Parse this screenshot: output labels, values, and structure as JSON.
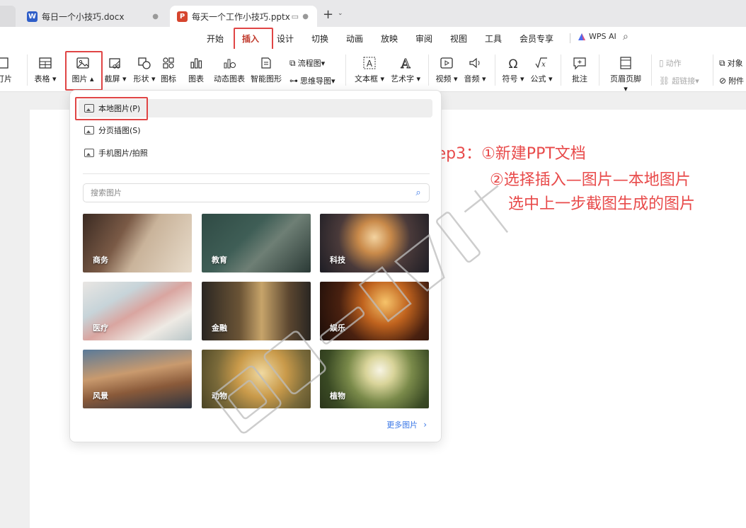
{
  "tabs": {
    "doc1": "每日一个小技巧.docx",
    "doc2": "每天一个工作小技巧.pptx",
    "new_tab": "+"
  },
  "ribbon_tabs": [
    "开始",
    "插入",
    "设计",
    "切换",
    "动画",
    "放映",
    "审阅",
    "视图",
    "工具",
    "会员专享"
  ],
  "active_tab": "插入",
  "wps_ai": "WPS AI",
  "toolbar": {
    "t_partial": "订片",
    "table": "表格",
    "picture": "图片",
    "screenshot": "截屏",
    "shape": "形状",
    "icon": "图标",
    "chart": "图表",
    "dynamic_chart": "动态图表",
    "smart_shape": "智能图形",
    "flowchart": "流程图",
    "mindmap": "思维导图",
    "textbox": "文本框",
    "wordart": "艺术字",
    "video": "视频",
    "audio": "音频",
    "symbol": "符号",
    "formula": "公式",
    "comment": "批注",
    "header_footer": "页眉页脚",
    "action": "动作",
    "hyperlink": "超链接",
    "object": "对象",
    "attachment": "附件"
  },
  "dropdown": {
    "local_picture": "本地图片(P)",
    "split_picture": "分页插图(S)",
    "phone_picture": "手机图片/拍照",
    "search_placeholder": "搜索图片",
    "categories": [
      "商务",
      "教育",
      "科技",
      "医疗",
      "金融",
      "娱乐",
      "风景",
      "动物",
      "植物"
    ],
    "more": "更多图片"
  },
  "annotation": {
    "line1": "Step3：①新建PPT文档",
    "line2": "②选择插入—图片—本地图片",
    "line3": "选中上一步截图生成的图片"
  },
  "colors": {
    "accent_red": "#e04545",
    "annotation_red": "#e84a4a",
    "link_blue": "#3b78e7"
  }
}
